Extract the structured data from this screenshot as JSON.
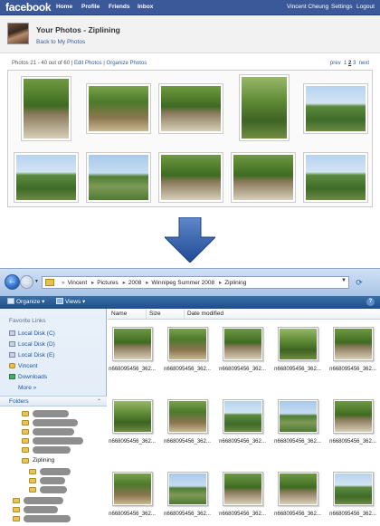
{
  "facebook": {
    "logo": "facebook",
    "nav": [
      "Home",
      "Profile",
      "Friends",
      "Inbox"
    ],
    "user_name": "Vincent Cheung",
    "settings": "Settings",
    "logout": "Logout",
    "album_title": "Your Photos - Ziplining",
    "back_link": "Back to My Photos",
    "photo_range": "Photos 21 - 40 out of 60",
    "edit_photos": "Edit Photos",
    "organize_photos": "Organize Photos",
    "pager": {
      "prev": "prev",
      "pages": [
        "1",
        "2",
        "3"
      ],
      "current": "2",
      "next": "next"
    },
    "brand_color": "#3b5998"
  },
  "explorer": {
    "breadcrumb": [
      "Vincent",
      "Pictures",
      "2008",
      "Winnipeg Summer 2008",
      "Ziplining"
    ],
    "toolbar": {
      "organize": "Organize",
      "views": "Views"
    },
    "favorite_links_title": "Favorite Links",
    "favorite_links": [
      "Local Disk (C)",
      "Local Disk (D)",
      "Local Disk (E)",
      "Vincent",
      "Downloads"
    ],
    "more": "More",
    "folders_title": "Folders",
    "selected_folder": "Ziplining",
    "columns": [
      "Name",
      "Size",
      "Date modified"
    ],
    "file_label": "n668095456_362..."
  }
}
